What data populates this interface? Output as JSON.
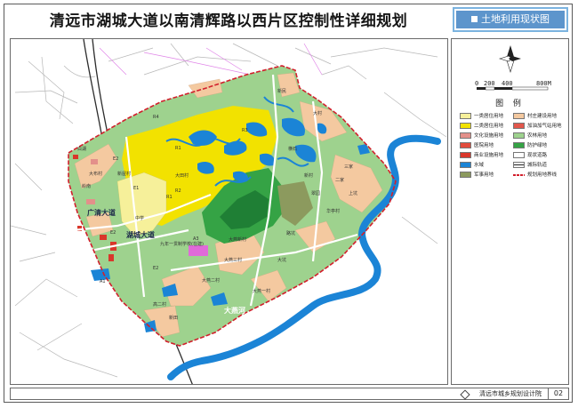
{
  "page": {
    "title": "清远市湖城大道以南清辉路以西片区控制性详细规划",
    "badge_label": "土地利用现状图",
    "footer_org": "清远市城乡规划设计院",
    "page_number": "02"
  },
  "scale_bar": {
    "ticks": [
      "0",
      "200",
      "400",
      "800M"
    ]
  },
  "legend": {
    "title": "图 例",
    "items": [
      {
        "label": "一类居住用地",
        "color": "#f6f09a"
      },
      {
        "label": "村庄建设用地",
        "color": "#f4c9a0"
      },
      {
        "label": "二类居住用地",
        "color": "#f2e200"
      },
      {
        "label": "加油加气站用地",
        "color": "#e2574c"
      },
      {
        "label": "文化设施用地",
        "color": "#e3908a"
      },
      {
        "label": "农林用地",
        "color": "#9ed28e"
      },
      {
        "label": "医院用地",
        "color": "#e14b3c"
      },
      {
        "label": "防护绿地",
        "color": "#35a345"
      },
      {
        "label": "商业设施用地",
        "color": "#d9372b"
      },
      {
        "label": "现状道路",
        "color": "#ffffff"
      },
      {
        "label": "水域",
        "color": "#1b84d6"
      },
      {
        "label": "城际轨道",
        "color": "#222222"
      },
      {
        "label": "军事用地",
        "color": "#8c9a5e"
      },
      {
        "label": "规划用地界线",
        "color": "#d21f2c"
      }
    ]
  },
  "map_labels": {
    "river": "大燕河",
    "road_guangqing": "广清大道",
    "road_hucheng": "湖城大道",
    "labels": [
      "R1",
      "R2",
      "R3",
      "R4",
      "E2",
      "E2",
      "E2",
      "E1",
      "A1",
      "A3",
      "R1",
      "大田村",
      "新屋村",
      "大布村",
      "中学",
      "九年一贯制学校(在建)",
      "大燕新村",
      "大燕三村",
      "大燕一村",
      "大燕二村",
      "横石",
      "三家",
      "二家",
      "上坑",
      "路坑",
      "大坑",
      "新田",
      "高二村",
      "大村",
      "新民",
      "岭南",
      "白湖",
      "华亭村",
      "翠园",
      "新村"
    ]
  },
  "colors": {
    "badge_bg": "#5d95cc",
    "boundary": "#d21f2c",
    "water": "#1b84d6",
    "agri": "#9ed28e",
    "village": "#f4c9a0",
    "res2": "#f2e200",
    "res1": "#f6f09a",
    "forest": "#35a345",
    "military": "#8c9a5e"
  }
}
